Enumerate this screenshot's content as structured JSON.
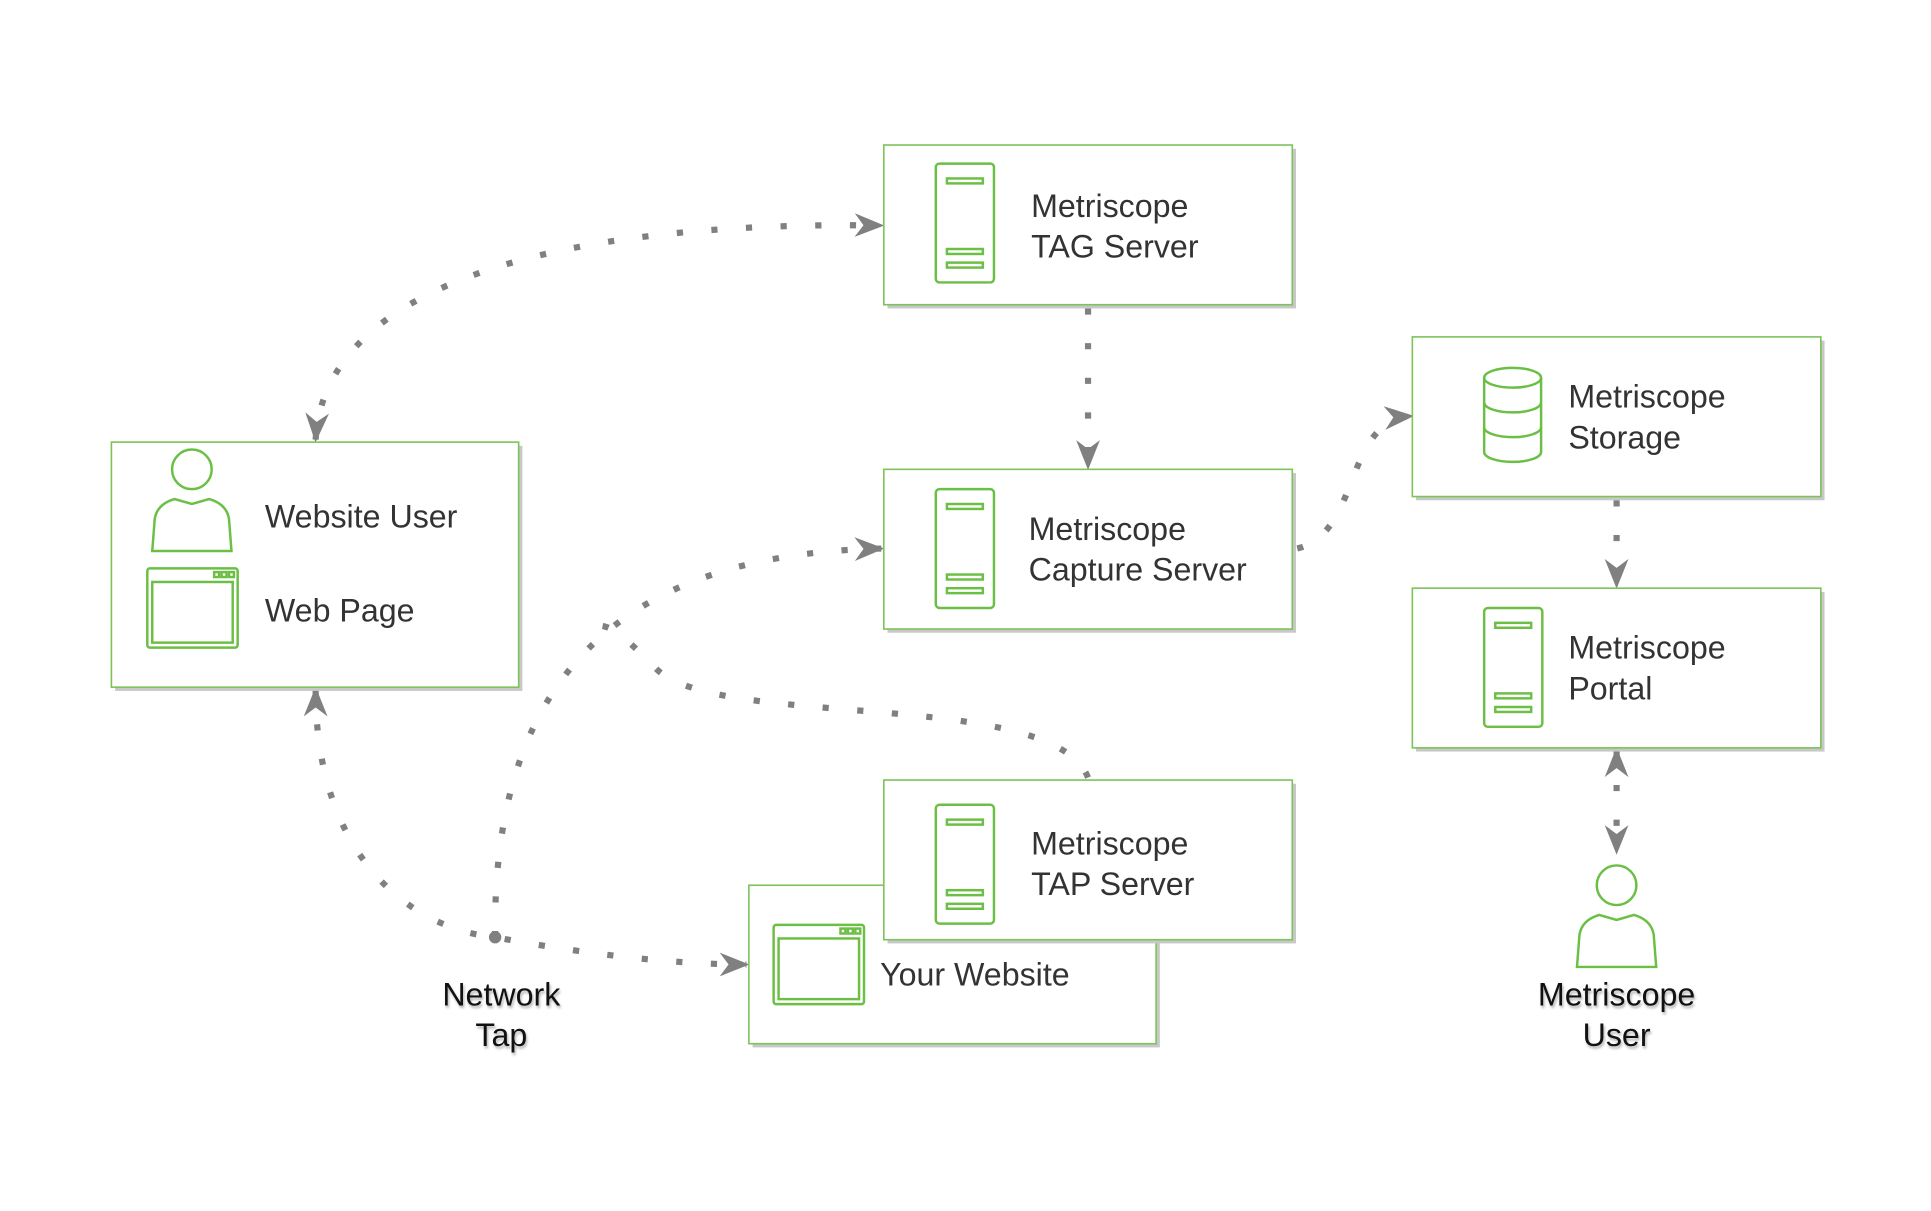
{
  "colors": {
    "accent": "#6cbf45",
    "connector": "#808080",
    "text": "#333333"
  },
  "nodes": {
    "tag_server": {
      "line1": "Metriscope",
      "line2": "TAG Server",
      "icon": "server-icon"
    },
    "website_user": {
      "user_label": "Website User",
      "page_label": "Web Page",
      "icons": [
        "user-icon",
        "browser-window-icon"
      ]
    },
    "capture_server": {
      "line1": "Metriscope",
      "line2": "Capture Server",
      "icon": "server-icon"
    },
    "storage": {
      "line1": "Metriscope",
      "line2": "Storage",
      "icon": "database-icon"
    },
    "portal": {
      "line1": "Metriscope",
      "line2": "Portal",
      "icon": "server-icon"
    },
    "tap_server": {
      "line1": "Metriscope",
      "line2": "TAP Server",
      "icon": "server-icon"
    },
    "your_website": {
      "label": "Your Website",
      "icon": "browser-window-icon"
    },
    "network_tap": {
      "line1": "Network",
      "line2": "Tap"
    },
    "metriscope_user": {
      "line1": "Metriscope",
      "line2": "User",
      "icon": "user-icon"
    }
  }
}
